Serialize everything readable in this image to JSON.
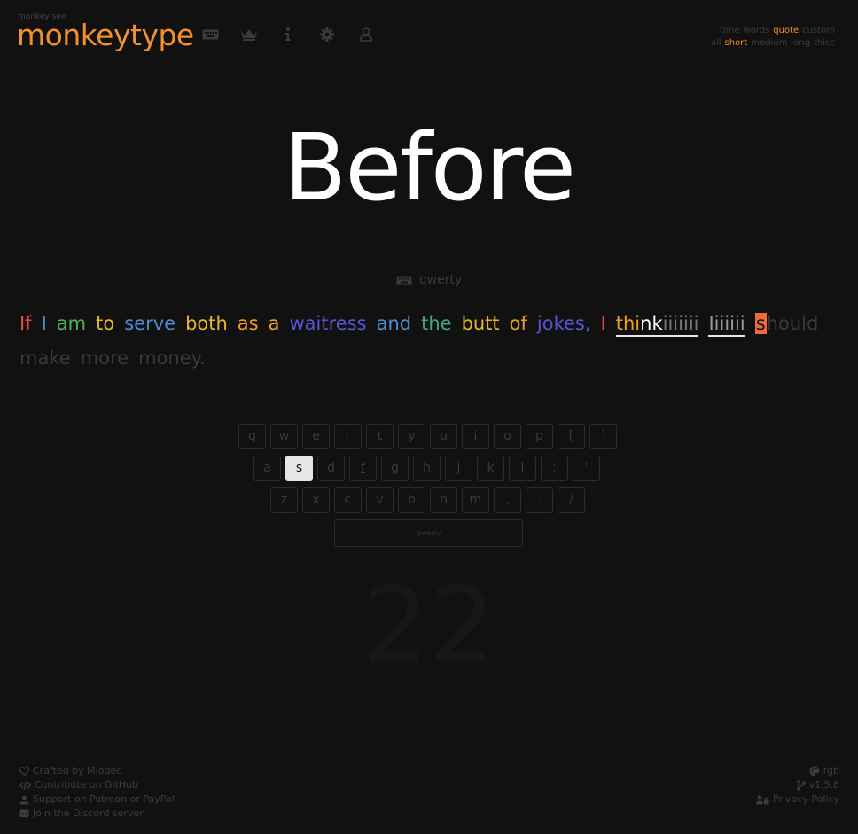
{
  "header": {
    "tagline": "monkey see",
    "logo": "monkeytype",
    "nav_icons": [
      "keyboard-icon",
      "crown-icon",
      "info-icon",
      "gear-icon",
      "user-icon"
    ]
  },
  "modes": {
    "row1": [
      {
        "label": "time",
        "active": false
      },
      {
        "label": "words",
        "active": false
      },
      {
        "label": "quote",
        "active": true
      },
      {
        "label": "custom",
        "active": false
      }
    ],
    "row2": [
      {
        "label": "all",
        "active": false
      },
      {
        "label": "short",
        "active": true
      },
      {
        "label": "medium",
        "active": false
      },
      {
        "label": "long",
        "active": false
      },
      {
        "label": "thicc",
        "active": false
      }
    ]
  },
  "big_word": "Before",
  "layout_name": "qwerty",
  "words": {
    "w1": "If",
    "w2": "I",
    "w3": "am",
    "w4": "to",
    "w5": "serve",
    "w6": "both",
    "w7": "as",
    "w8": "a",
    "w9": "waitress",
    "w10": "and",
    "w11": "the",
    "w12": "butt",
    "w13": "of",
    "w14": "jokes,",
    "w15": "I",
    "w16a": "thi",
    "w16b": "nk",
    "w16c": "iiiiiii",
    "w17": "Iiiiiii",
    "w18a": "s",
    "w18b": "hould",
    "w19": "make",
    "w20": "more",
    "w21": "money."
  },
  "keyboard": {
    "row1": [
      "q",
      "w",
      "e",
      "r",
      "t",
      "y",
      "u",
      "i",
      "o",
      "p",
      "[",
      "]"
    ],
    "row2": [
      "a",
      "s",
      "d",
      "f",
      "g",
      "h",
      "j",
      "k",
      "l",
      ";",
      "'"
    ],
    "row3": [
      "z",
      "x",
      "c",
      "v",
      "b",
      "n",
      "m",
      ",",
      ".",
      "/"
    ],
    "space_label": "qwerty",
    "active_key": "s"
  },
  "timer": "22",
  "footer": {
    "left": [
      "Crafted by Miodec",
      "Contribute on GitHub",
      "Support on Patreon or PayPal",
      "Join the Discord server"
    ],
    "theme": "rgb",
    "version": "v1.5.8",
    "privacy": "Privacy Policy"
  },
  "colors": {
    "accent": "#f28f2e",
    "background": "#111111",
    "caret": "#ee6b3a"
  }
}
